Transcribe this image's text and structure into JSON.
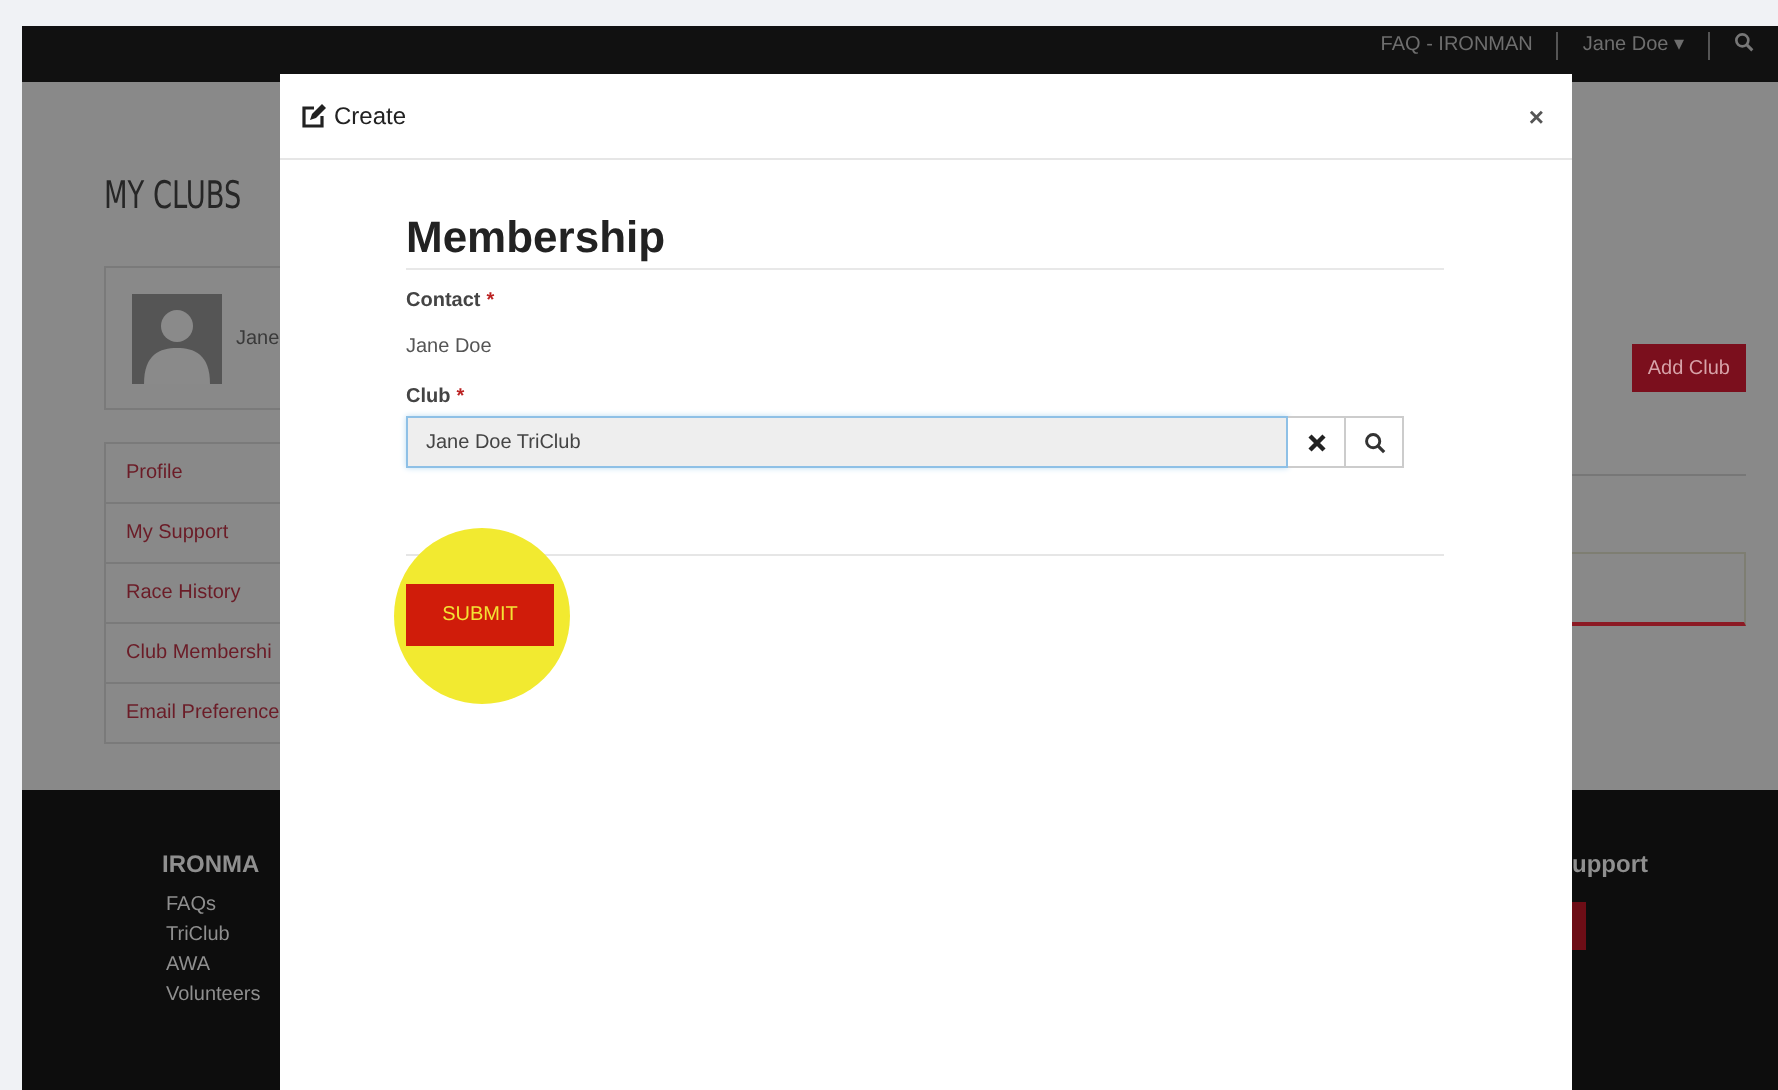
{
  "top_nav": {
    "faq_link": "FAQ - IRONMAN",
    "user_menu": "Jane Doe",
    "user_caret": "▾"
  },
  "page": {
    "title": "MY CLUBS",
    "profile_name": "Jane",
    "menu": [
      {
        "label": "Profile"
      },
      {
        "label": "My Support"
      },
      {
        "label": "Race History"
      },
      {
        "label": "Club Membershi"
      },
      {
        "label": "Email Preference"
      }
    ],
    "add_button": "Add Club"
  },
  "footer": {
    "left_heading": "IRONMA",
    "left_links": [
      "FAQs",
      "TriClub",
      "AWA",
      "Volunteers"
    ],
    "right_heading": "upport"
  },
  "modal": {
    "title": "Create",
    "close": "×",
    "heading": "Membership",
    "fields": [
      {
        "kind": "static",
        "label": "Contact",
        "required_mark": "*",
        "value": "Jane Doe"
      },
      {
        "kind": "lookup",
        "label": "Club",
        "required_mark": "*",
        "value": "Jane Doe TriClub",
        "focused": true
      }
    ],
    "submit": "SUBMIT",
    "submit_highlighted": true
  }
}
